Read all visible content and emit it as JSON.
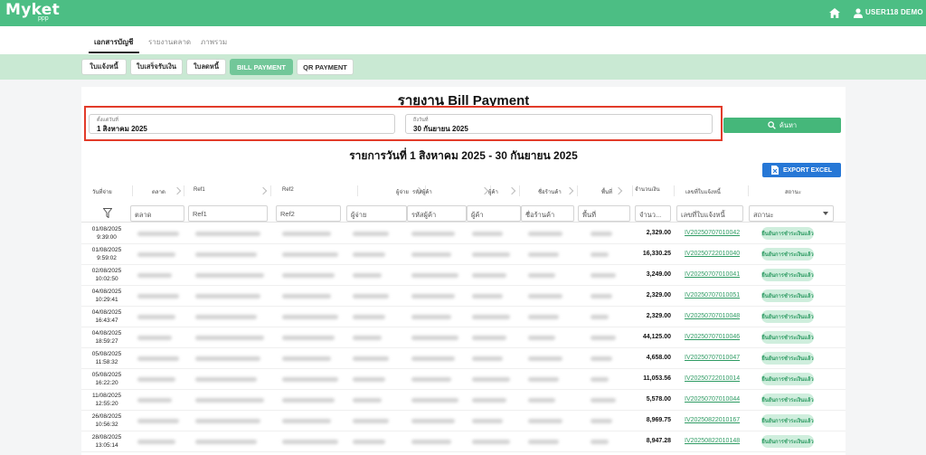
{
  "app": {
    "logo": "Myket",
    "logo_sub": "ppp",
    "user": "USER118 DEMO"
  },
  "nav": {
    "tabs": [
      {
        "label": "เอกสารบัญชี",
        "active": true
      },
      {
        "label": "รายงานตลาด",
        "active": false
      },
      {
        "label": "ภาพรวม",
        "active": false
      }
    ]
  },
  "toolbar": {
    "buttons": [
      {
        "label": "ใบแจ้งหนี้",
        "active": false
      },
      {
        "label": "ใบเสร็จรับเงิน",
        "active": false
      },
      {
        "label": "ใบลดหนี้",
        "active": false
      },
      {
        "label": "BILL PAYMENT",
        "active": true
      },
      {
        "label": "QR PAYMENT",
        "active": false
      }
    ]
  },
  "report": {
    "title": "รายงาน Bill Payment",
    "start_label": "ตั้งแต่วันที่",
    "start_value": "1 สิงหาคม 2025",
    "end_label": "ถึงวันที่",
    "end_value": "30 กันยายน 2025",
    "search_label": "ค้นหา",
    "range_title": "รายการวันที่ 1 สิงหาคม 2025 - 30 กันยายน 2025",
    "export_label": "EXPORT EXCEL"
  },
  "table": {
    "headers": [
      "วันที่จ่าย",
      "ตลาด",
      "Ref1",
      "Ref2",
      "ผู้จ่าย",
      "รหัสผู้ค้า",
      "ผู้ค้า",
      "ชื่อร้านค้า",
      "พื้นที่",
      "จำนวนเงิน",
      "เลขที่ใบแจ้งหนี้",
      "สถานะ"
    ],
    "filters": [
      "ตลาด",
      "Ref1",
      "Ref2",
      "ผู้จ่าย",
      "รหัสผู้ค้า",
      "ผู้ค้า",
      "ชื่อร้านค้า",
      "พื้นที่",
      "จำนว...",
      "เลขที่ใบแจ้งหนี้",
      "สถานะ"
    ],
    "rows": [
      {
        "date": "01/08/2025",
        "time": "9:39:00",
        "amount": "2,329.00",
        "invoice": "IV20250707010042",
        "status": "ยืนยันการชำระเงินแล้ว"
      },
      {
        "date": "01/08/2025",
        "time": "9:59:02",
        "amount": "16,330.25",
        "invoice": "IV20250722010040",
        "status": "ยืนยันการชำระเงินแล้ว"
      },
      {
        "date": "02/08/2025",
        "time": "10:02:50",
        "amount": "3,249.00",
        "invoice": "IV20250707010041",
        "status": "ยืนยันการชำระเงินแล้ว"
      },
      {
        "date": "04/08/2025",
        "time": "10:29:41",
        "amount": "2,329.00",
        "invoice": "IV20250707010051",
        "status": "ยืนยันการชำระเงินแล้ว"
      },
      {
        "date": "04/08/2025",
        "time": "16:43:47",
        "amount": "2,329.00",
        "invoice": "IV20250707010048",
        "status": "ยืนยันการชำระเงินแล้ว"
      },
      {
        "date": "04/08/2025",
        "time": "18:59:27",
        "amount": "44,125.00",
        "invoice": "IV20250707010046",
        "status": "ยืนยันการชำระเงินแล้ว"
      },
      {
        "date": "05/08/2025",
        "time": "11:58:32",
        "amount": "4,658.00",
        "invoice": "IV20250707010047",
        "status": "ยืนยันการชำระเงินแล้ว"
      },
      {
        "date": "05/08/2025",
        "time": "16:22:20",
        "amount": "11,053.56",
        "invoice": "IV20250722010014",
        "status": "ยืนยันการชำระเงินแล้ว"
      },
      {
        "date": "11/08/2025",
        "time": "12:55:20",
        "amount": "5,578.00",
        "invoice": "IV20250707010044",
        "status": "ยืนยันการชำระเงินแล้ว"
      },
      {
        "date": "26/08/2025",
        "time": "10:56:32",
        "amount": "8,969.75",
        "invoice": "IV20250822010167",
        "status": "ยืนยันการชำระเงินแล้ว"
      },
      {
        "date": "28/08/2025",
        "time": "13:05:14",
        "amount": "8,947.28",
        "invoice": "IV20250822010148",
        "status": "ยืนยันการชำระเงินแล้ว"
      }
    ]
  },
  "icons": {
    "home": "home-icon",
    "user": "user-icon",
    "search": "search-icon",
    "export": "file-excel-icon",
    "filter": "funnel-icon"
  },
  "colors": {
    "brand": "#4cbe84",
    "toolbar_bg": "#c9e9d3",
    "highlight": "#e23b2a",
    "export": "#2677d6",
    "status_bg": "#cfeedd",
    "status_text": "#2e9b63"
  }
}
